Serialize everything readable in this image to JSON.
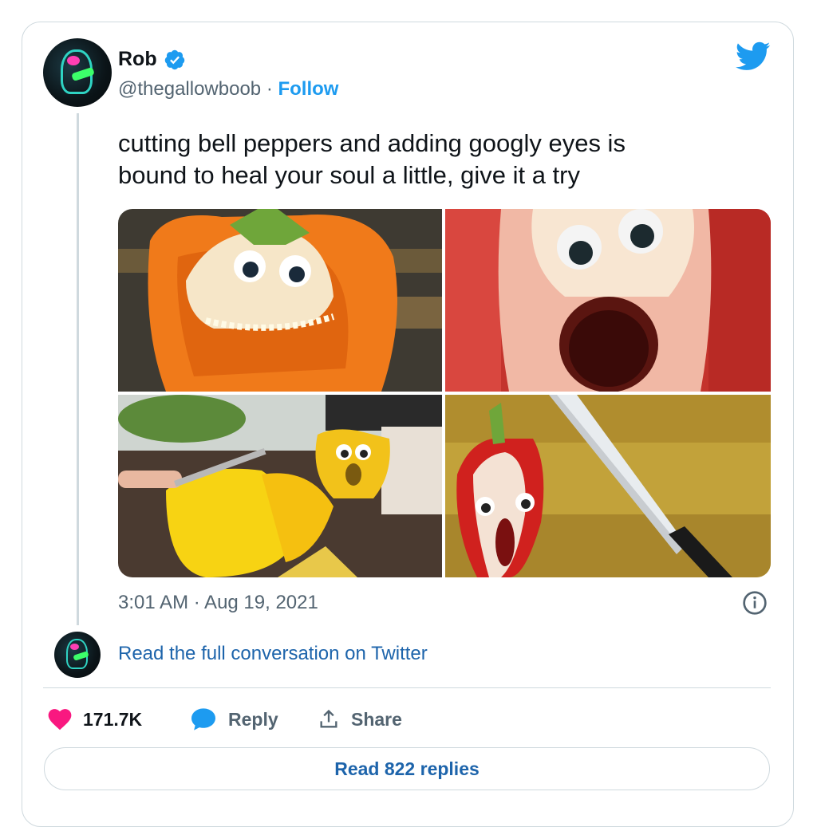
{
  "author": {
    "name": "Rob",
    "handle": "@thegallowboob",
    "separator": " · ",
    "follow_label": "Follow"
  },
  "tweet": {
    "text_line1": "cutting bell peppers and adding googly eyes is",
    "text_line2": "bound to heal your soul a little, give it a try",
    "timestamp": "3:01 AM · Aug 19, 2021"
  },
  "conversation": {
    "read_full_label": "Read the full conversation on Twitter"
  },
  "actions": {
    "likes": "171.7K",
    "reply_label": "Reply",
    "share_label": "Share",
    "read_replies_label": "Read 822 replies"
  },
  "icons": [
    "verified-badge-icon",
    "twitter-bird-icon",
    "info-icon",
    "heart-icon",
    "reply-bubble-icon",
    "share-icon"
  ],
  "colors": {
    "accent": "#1d9bf0",
    "link": "#1d64ab",
    "like": "#f91880",
    "muted": "#536471",
    "border": "#cfd9de"
  }
}
